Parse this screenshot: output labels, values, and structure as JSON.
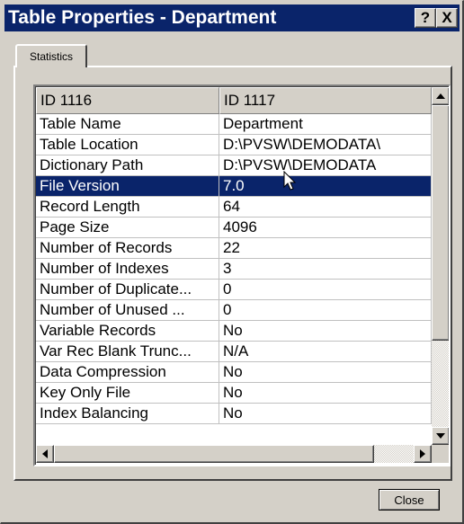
{
  "window": {
    "title": "Table Properties - Department",
    "help_label": "?",
    "close_label": "X"
  },
  "tabs": [
    {
      "label": "Statistics",
      "selected": true
    }
  ],
  "grid": {
    "columns": [
      "ID 1116",
      "ID 1117"
    ],
    "selected_row_index": 3,
    "rows": [
      {
        "name": "Table Name",
        "value": "Department"
      },
      {
        "name": "Table Location",
        "value": "D:\\PVSW\\DEMODATA\\"
      },
      {
        "name": "Dictionary Path",
        "value": "D:\\PVSW\\DEMODATA"
      },
      {
        "name": "File Version",
        "value": "7.0"
      },
      {
        "name": "Record Length",
        "value": "64"
      },
      {
        "name": "Page Size",
        "value": "4096"
      },
      {
        "name": "Number of Records",
        "value": "22"
      },
      {
        "name": "Number of Indexes",
        "value": "3"
      },
      {
        "name": "Number of Duplicate...",
        "value": "0"
      },
      {
        "name": "Number of Unused ...",
        "value": "0"
      },
      {
        "name": "Variable Records",
        "value": "No"
      },
      {
        "name": "Var Rec Blank Trunc...",
        "value": "N/A"
      },
      {
        "name": "Data Compression",
        "value": "No"
      },
      {
        "name": "Key Only File",
        "value": "No"
      },
      {
        "name": "Index Balancing",
        "value": "No"
      }
    ]
  },
  "footer": {
    "close_button": "Close"
  },
  "colors": {
    "titlebar": "#0a246a",
    "selection": "#0a246a",
    "face": "#d4d0c8"
  }
}
